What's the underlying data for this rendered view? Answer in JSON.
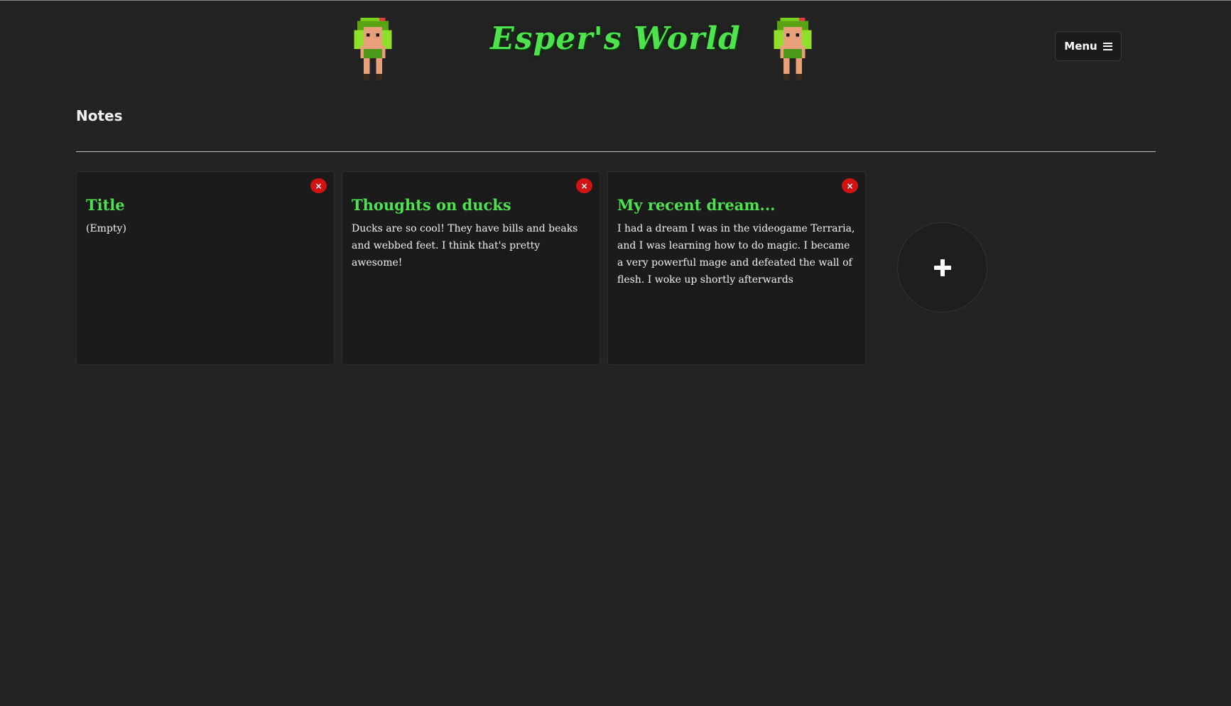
{
  "header": {
    "site_title": "Esper's World",
    "menu_label": "Menu",
    "menu_icon": "hamburger-icon",
    "sprite_icon": "dryad-sprite-icon"
  },
  "page": {
    "heading": "Notes"
  },
  "notes": [
    {
      "title": "Title",
      "body": "(Empty)",
      "delete_label": "×"
    },
    {
      "title": "Thoughts on ducks",
      "body": "Ducks are so cool! They have bills and beaks and webbed feet. I think that's pretty awesome!",
      "delete_label": "×"
    },
    {
      "title": "My recent dream...",
      "body": "I had a dream I was in the videogame Terraria, and I was learning how to do magic. I became a very powerful mage and defeated the wall of flesh. I woke up shortly afterwards",
      "delete_label": "×"
    }
  ],
  "add_button": {
    "icon": "plus-icon"
  },
  "colors": {
    "background": "#232323",
    "accent_green": "#4ee24e",
    "card": "#1b1b1b",
    "delete_red": "#d01414"
  }
}
